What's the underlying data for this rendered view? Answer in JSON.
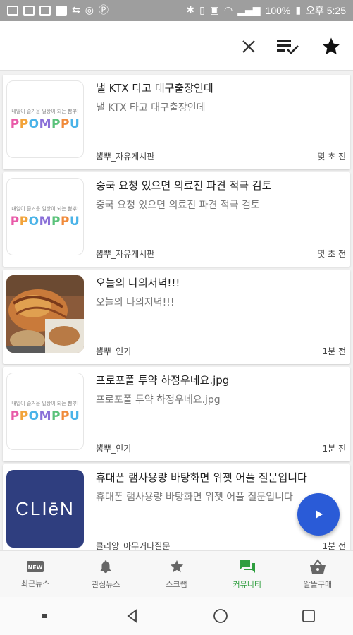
{
  "status_bar": {
    "battery": "100%",
    "time": "오후 5:25"
  },
  "search": {
    "value": "",
    "placeholder": ""
  },
  "header_icons": {
    "clear": "close-icon",
    "select": "checklist-icon",
    "favorite": "star-icon"
  },
  "posts": [
    {
      "title": "낼 KTX 타고 대구출장인데",
      "summary": "낼 KTX 타고 대구출장인데",
      "source": "뽐뿌_자유게시판",
      "time": "몇 초 전",
      "thumb": "ppomppu"
    },
    {
      "title": "중국 요청 있으면 의료진 파견 적극 검토",
      "summary": "중국 요청 있으면 의료진 파견 적극 검토",
      "source": "뽐뿌_자유게시판",
      "time": "몇 초 전",
      "thumb": "ppomppu"
    },
    {
      "title": "오늘의 나의저녁!!!",
      "summary": "오늘의 나의저녁!!!",
      "source": "뽐뿌_인기",
      "time": "1분 전",
      "thumb": "food-photo"
    },
    {
      "title": "프로포폴 투약 하정우네요.jpg",
      "summary": "프로포폴 투약 하정우네요.jpg",
      "source": "뽐뿌_인기",
      "time": "1분 전",
      "thumb": "ppomppu"
    },
    {
      "title": "휴대폰 램사용량 바탕화면 위젯 어플 질문입니다",
      "summary": "휴대폰 램사용량 바탕화면 위젯 어플 질문입니다",
      "source": "클리앙_아무거나질문",
      "time": "1분 전",
      "thumb": "clien"
    }
  ],
  "logos": {
    "ppomppu_tagline": "내일이 즐거운 일상이 되는 뽐뿌!",
    "ppomppu_word": "PPOMPPU",
    "clien_word": "CLIēN"
  },
  "bottom_nav": [
    {
      "label": "최근뉴스",
      "icon": "new-badge-icon"
    },
    {
      "label": "관심뉴스",
      "icon": "bell-icon"
    },
    {
      "label": "스크랩",
      "icon": "star-icon"
    },
    {
      "label": "커뮤니티",
      "icon": "chat-icon",
      "active": true
    },
    {
      "label": "알뜰구매",
      "icon": "basket-icon"
    }
  ],
  "colors": {
    "accent_active": "#2e9e3e",
    "fab": "#2a5bd7",
    "clien_bg": "#2f3e7f"
  }
}
